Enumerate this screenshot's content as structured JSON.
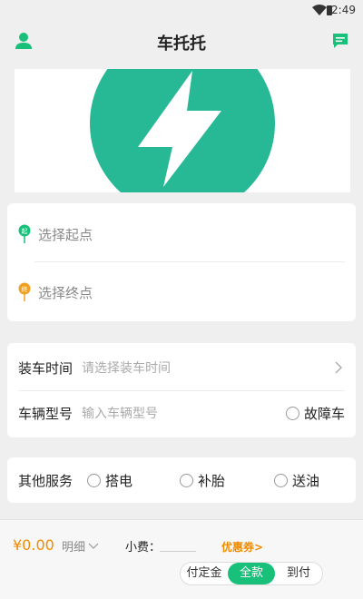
{
  "status_bar": {
    "time": "2:49"
  },
  "nav": {
    "title": "车托托"
  },
  "route": {
    "start_badge": "起",
    "start_placeholder": "选择起点",
    "end_badge": "终",
    "end_placeholder": "选择终点"
  },
  "info": {
    "load_time_label": "装车时间",
    "load_time_placeholder": "请选择装车时间",
    "vehicle_label": "车辆型号",
    "vehicle_placeholder": "输入车辆型号",
    "broken_option": "故障车"
  },
  "services": {
    "label": "其他服务",
    "options": [
      "搭电",
      "补胎",
      "送油"
    ]
  },
  "bottom": {
    "price": "¥0.00",
    "detail": "明细",
    "tip_label": "小费：",
    "coupon": "优惠券>",
    "payment_options": [
      "付定金",
      "全款",
      "到付"
    ],
    "selected_payment": "全款"
  },
  "colors": {
    "brand_green": "#18c07a",
    "banner_teal": "#27b996",
    "accent_orange": "#f08c00"
  }
}
